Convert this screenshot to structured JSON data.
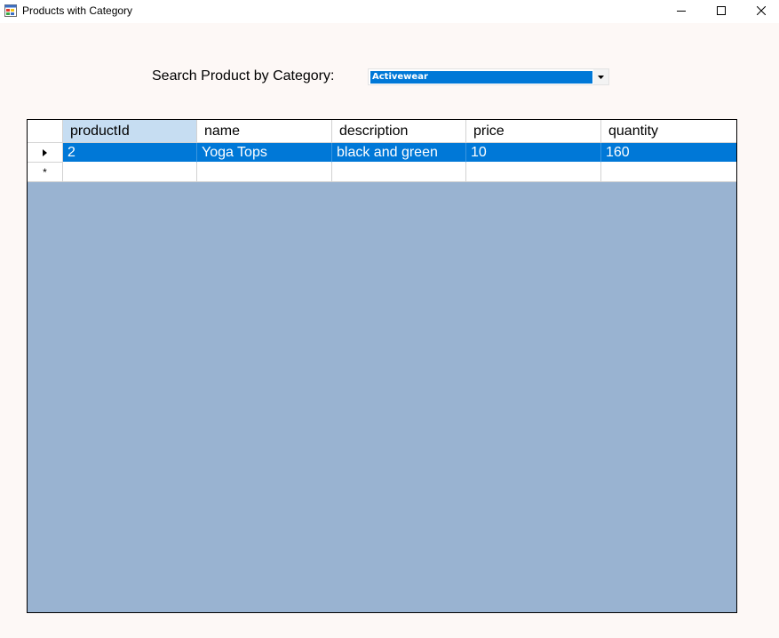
{
  "window": {
    "title": "Products with Category",
    "icon": "form-icon"
  },
  "search": {
    "label": "Search Product by Category:",
    "selected_category": "Activewear"
  },
  "grid": {
    "columns": [
      "productId",
      "name",
      "description",
      "price",
      "quantity"
    ],
    "rows": [
      [
        "2",
        "Yoga Tops",
        "black and green",
        "10",
        "160"
      ]
    ],
    "new_row_marker": "*"
  },
  "colors": {
    "selection": "#0078d7",
    "grid_background": "#99b3d1",
    "form_background": "#fdf8f6",
    "sorted_header": "#c6ddf2"
  }
}
